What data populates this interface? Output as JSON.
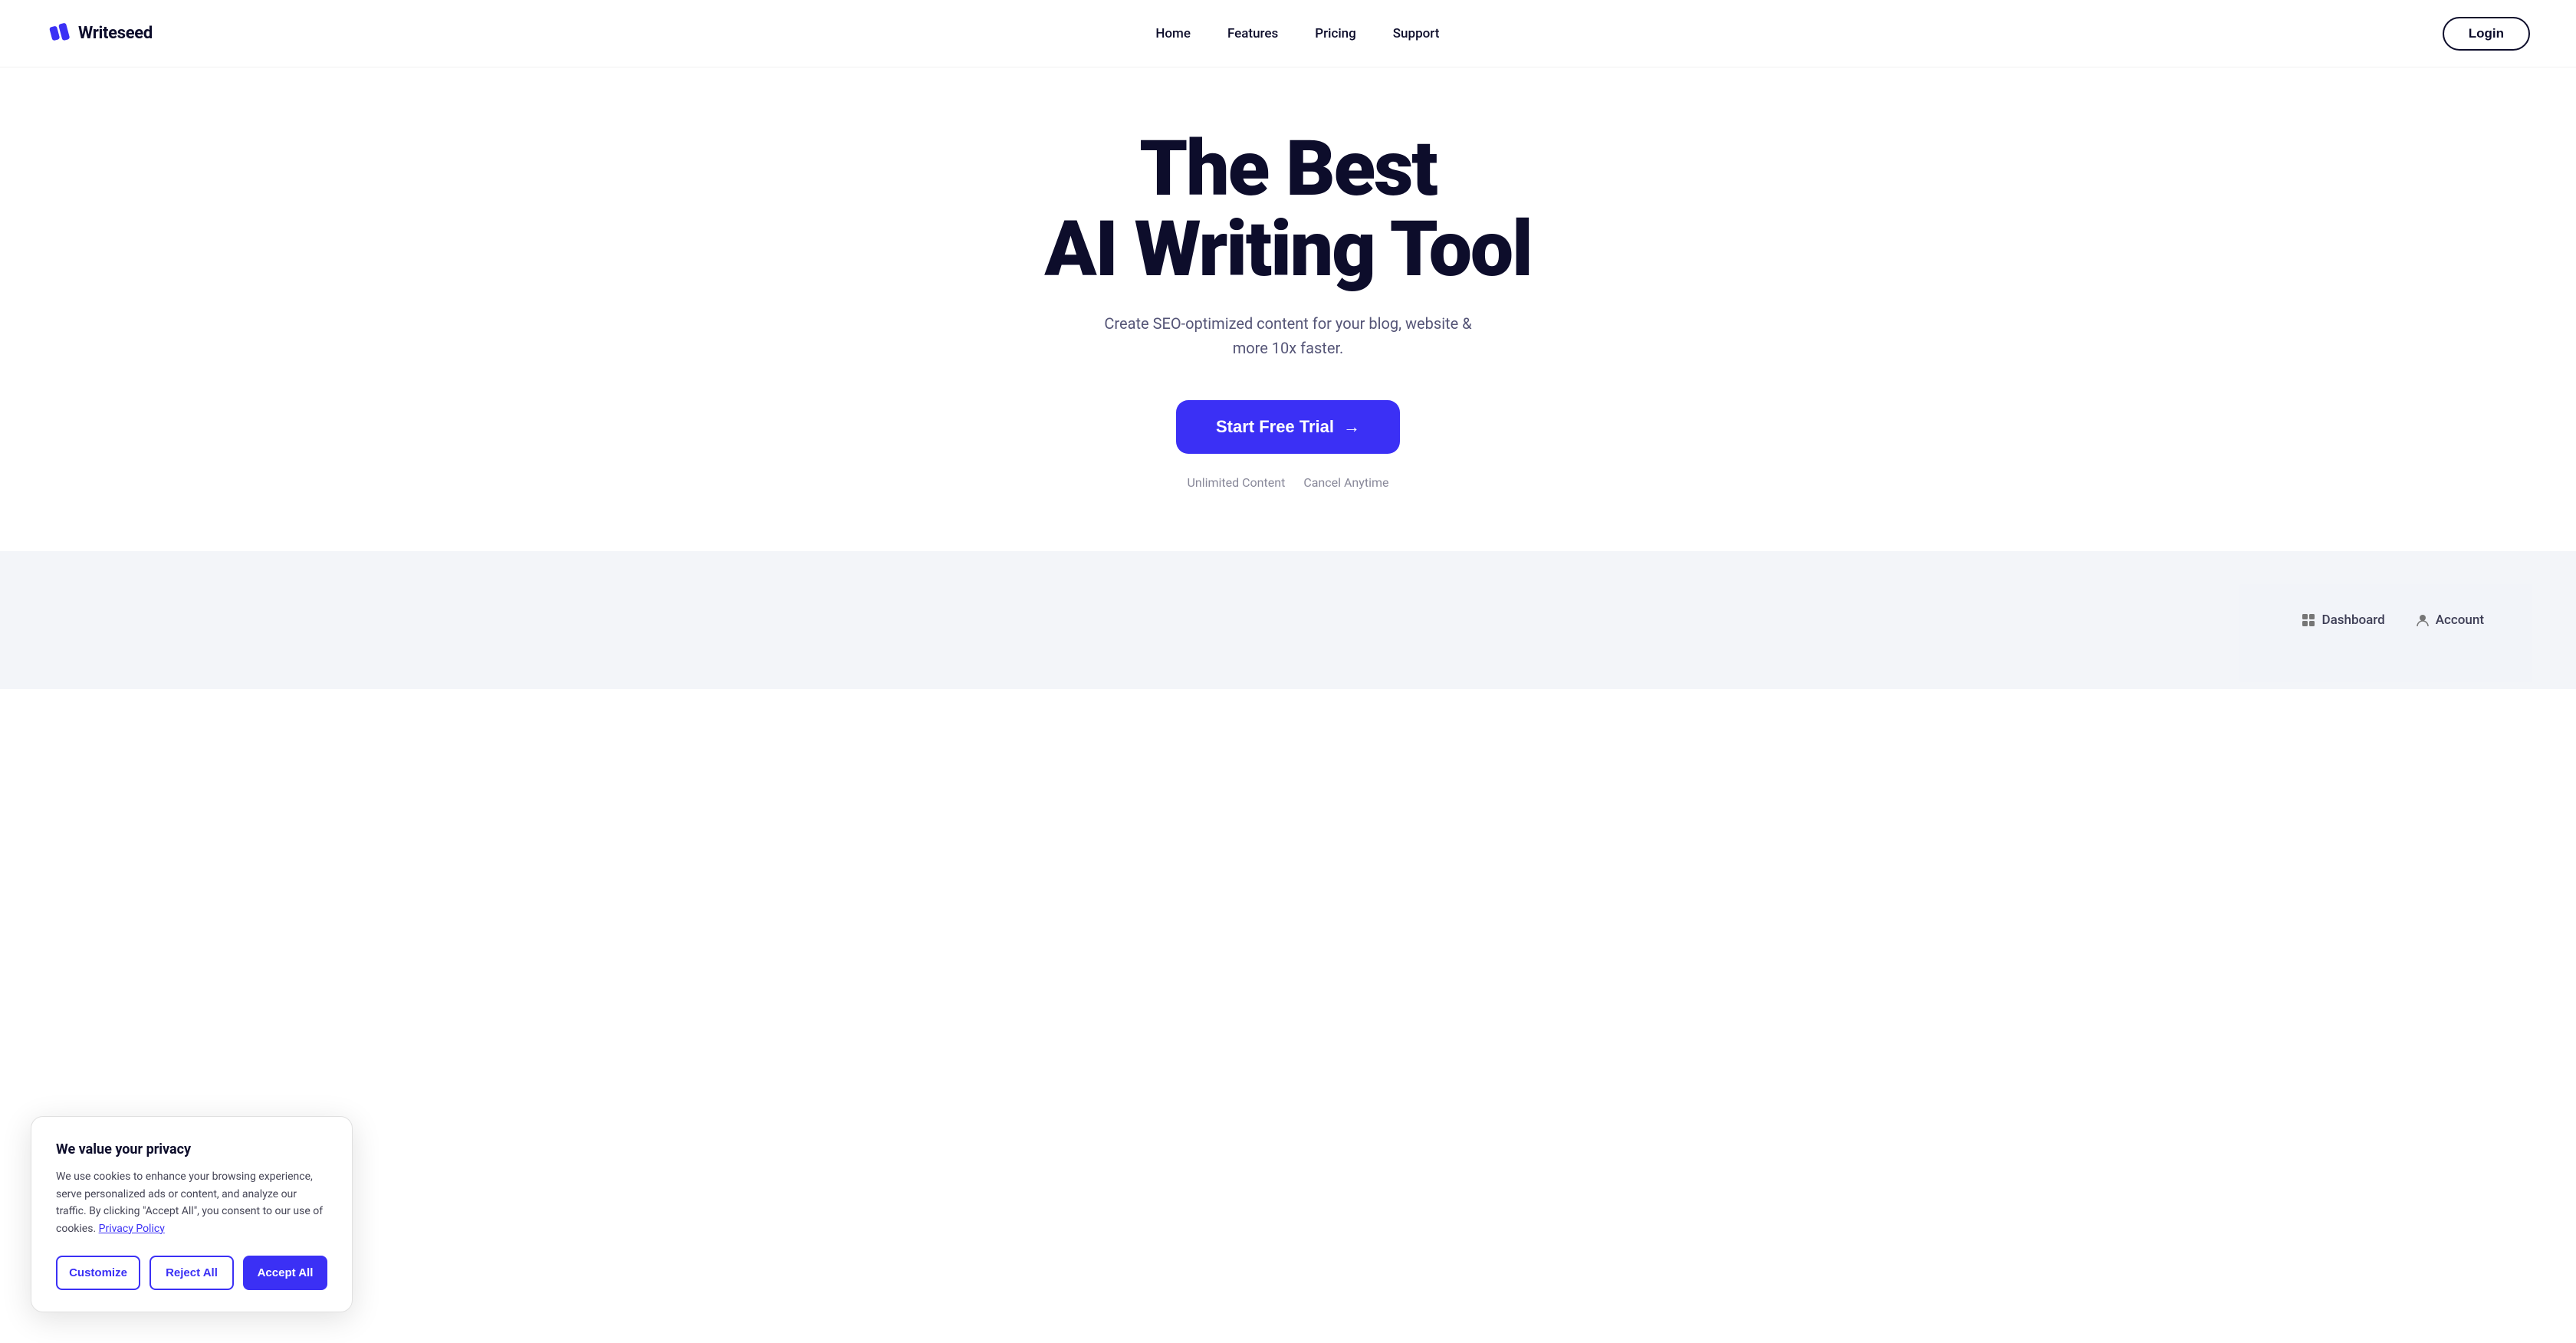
{
  "brand": {
    "name": "Writeseed",
    "logo_icon_color": "#3b30f5"
  },
  "nav": {
    "links": [
      {
        "label": "Home",
        "href": "#"
      },
      {
        "label": "Features",
        "href": "#"
      },
      {
        "label": "Pricing",
        "href": "#"
      },
      {
        "label": "Support",
        "href": "#"
      }
    ],
    "login_label": "Login"
  },
  "hero": {
    "title_line1": "The Best",
    "title_line2": "AI Writing Tool",
    "subtitle": "Create SEO-optimized content for your blog, website & more 10x faster.",
    "cta_label": "Start Free Trial",
    "badge1": "Unlimited Content",
    "badge2": "Cancel Anytime"
  },
  "strip": {
    "item1": "Dashboard",
    "item2": "Account"
  },
  "cookie": {
    "title": "We value your privacy",
    "body": "We use cookies to enhance your browsing experience, serve personalized ads or content, and analyze our traffic. By clicking \"Accept All\", you consent to our use of cookies.",
    "privacy_link": "Privacy Policy",
    "btn_customize": "Customize",
    "btn_reject": "Reject All",
    "btn_accept": "Accept All"
  }
}
